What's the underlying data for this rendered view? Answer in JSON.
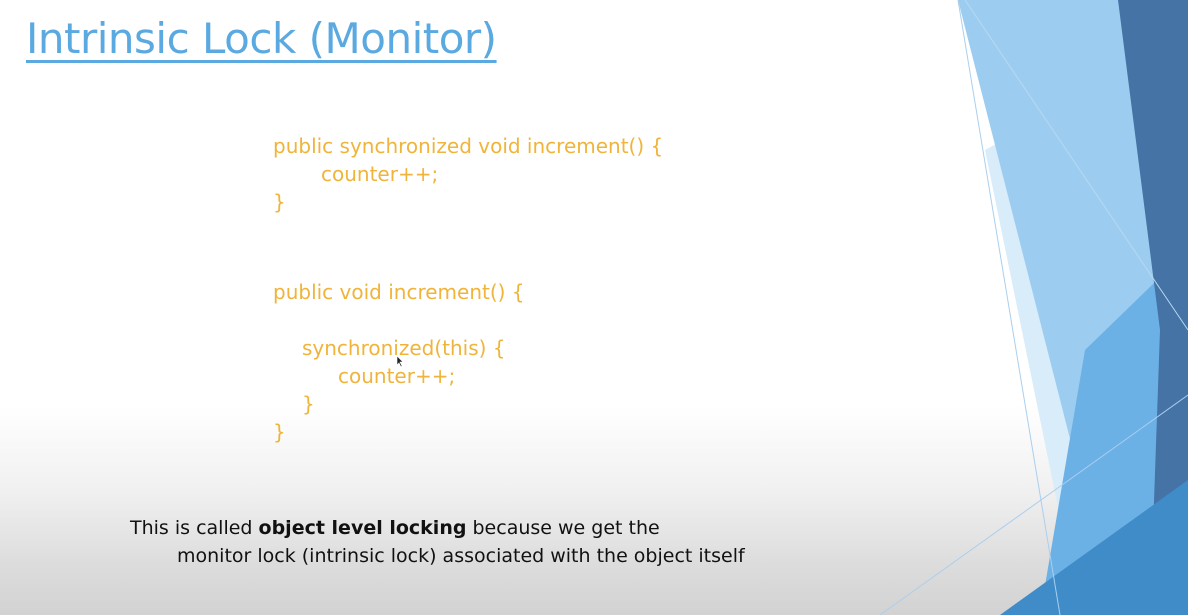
{
  "slide": {
    "title": "Intrinsic Lock (Monitor)",
    "code_block_1": [
      "public synchronized void increment() {",
      "counter++;",
      "}"
    ],
    "code_block_2": [
      "public void increment() {",
      "synchronized(this) {",
      "counter++;",
      "}",
      "}"
    ],
    "caption": {
      "prefix": "This is called ",
      "bold": "object level locking",
      "suffix": " because we get the",
      "line2": "monitor lock (intrinsic lock) associated with the object itself"
    }
  },
  "colors": {
    "title": "#5aa9e0",
    "code": "#f0b43a",
    "caption": "#111111",
    "decor_dark_blue": "#4573a6",
    "decor_light_blue": "#9ccdf0"
  }
}
